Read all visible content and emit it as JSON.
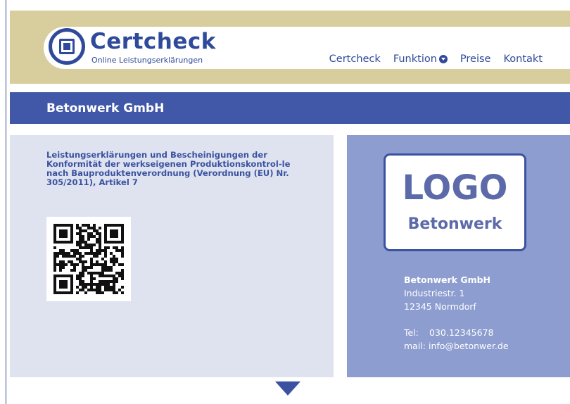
{
  "brand": {
    "name": "Certcheck",
    "tagline": "Online Leistungserklärungen",
    "logo_icon": "certcheck-logo-icon"
  },
  "nav": {
    "items": [
      {
        "label": "Certcheck"
      },
      {
        "label": "Funktion",
        "icon": "chevron-down-circle-icon"
      },
      {
        "label": "Preise"
      },
      {
        "label": "Kontakt"
      }
    ]
  },
  "page": {
    "title": "Betonwerk GmbH"
  },
  "declaration": {
    "text": "Leistungserklärungen und Bescheinigungen der Konformität der werkseigenen Produktionskontrol-le nach Bauproduktenverordnung (Verordnung (EU) Nr. 305/2011), Artikel 7"
  },
  "company": {
    "logo_word": "LOGO",
    "logo_sub": "Betonwerk",
    "name": "Betonwerk GmbH",
    "street": "Industriestr. 1",
    "city": "12345 Normdorf",
    "tel_label": "Tel:",
    "tel_value": "030.12345678",
    "mail_label": "mail:",
    "mail_value": "info@betonwer.de"
  },
  "colors": {
    "primary": "#2f4a9a",
    "title_bar": "#4158a8",
    "header_band": "#d8cd9c",
    "left_panel": "#dfe3f0",
    "right_panel": "#8d9dcf"
  }
}
